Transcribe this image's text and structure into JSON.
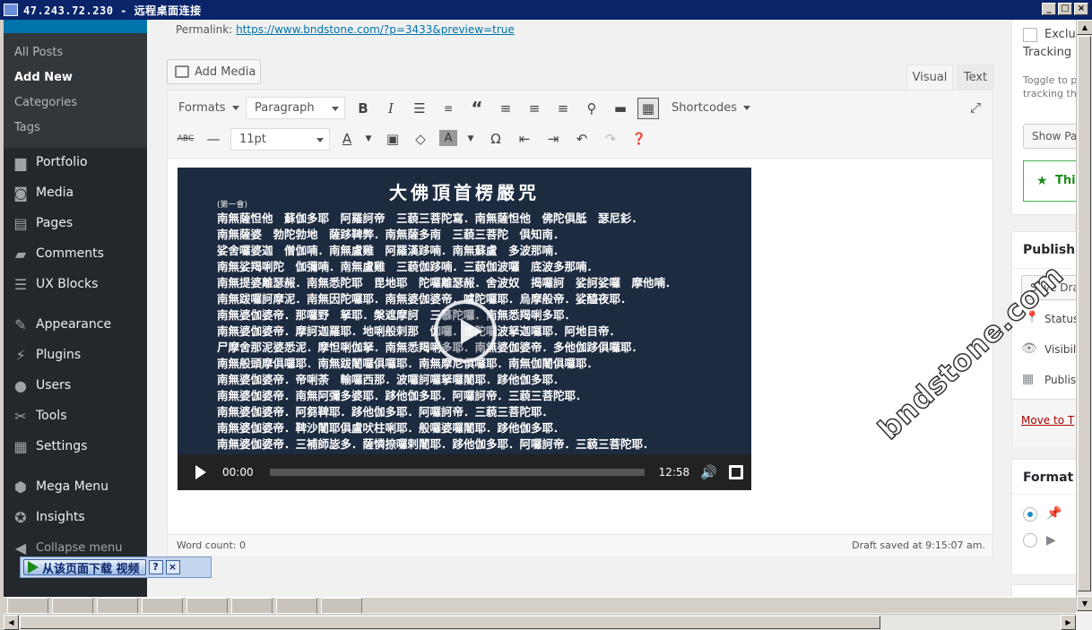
{
  "window": {
    "title": "47.243.72.230 - 远程桌面连接",
    "controls": [
      "_",
      "□",
      "×"
    ]
  },
  "sidebar": {
    "submenu": [
      "All Posts",
      "Add New",
      "Categories",
      "Tags"
    ],
    "items": [
      {
        "label": "Portfolio",
        "icon": "portfolio-icon"
      },
      {
        "label": "Media",
        "icon": "media-icon"
      },
      {
        "label": "Pages",
        "icon": "pages-icon"
      },
      {
        "label": "Comments",
        "icon": "comments-icon"
      },
      {
        "label": "UX Blocks",
        "icon": "ux-blocks-icon"
      },
      {
        "label": "Appearance",
        "icon": "appearance-icon"
      },
      {
        "label": "Plugins",
        "icon": "plugins-icon"
      },
      {
        "label": "Users",
        "icon": "users-icon"
      },
      {
        "label": "Tools",
        "icon": "tools-icon"
      },
      {
        "label": "Settings",
        "icon": "settings-icon"
      },
      {
        "label": "Mega Menu",
        "icon": "mega-menu-icon"
      },
      {
        "label": "Insights",
        "icon": "insights-icon"
      }
    ],
    "collapse": "Collapse menu"
  },
  "editor": {
    "permalink_label": "Permalink:",
    "permalink_url": "https://www.bndstone.com/?p=3433&preview=true",
    "add_media": "Add Media",
    "tab_visual": "Visual",
    "tab_text": "Text",
    "formats": "Formats",
    "paragraph": "Paragraph",
    "shortcodes": "Shortcodes",
    "font_size": "11pt",
    "word_count": "Word count: 0",
    "draft_saved": "Draft saved at 9:15:07 am."
  },
  "video": {
    "title": "大佛頂首楞嚴咒",
    "subtitle": "(第一會)",
    "lines": [
      "南無薩怛他　蘇伽多耶　阿羅訶帝　三藐三菩陀寫．南無薩怛他　佛陀俱胝　瑟尼釤．",
      "南無薩婆　勃陀勃地　薩跢鞞弊．南無薩多南　三藐三菩陀　俱知南．",
      "娑舍囉婆迦　僧伽喃．南無盧雞　阿羅漢跢喃．南無蘇盧　多波那喃．",
      "南無娑羯唎陀　伽彌喃．南無盧雞　三藐伽跢喃．三藐伽波囉　底波多那喃．",
      "南無提婆離瑟赧．南無悉陀耶　毘地耶　陀囉離瑟赧．舍波奴　揭囉訶　娑訶娑囉　摩他喃．",
      "南無跋囉訶摩泥．南無因陀囉耶．南無婆伽婆帝．嚧陀囉耶．烏摩般帝．娑醯夜耶．",
      "南無婆伽婆帝．那囉野　拏耶．槃遮摩訶　三慕陀囉．南無悉羯唎多耶．",
      "南無婆伽婆帝．摩訶迦羅耶．地唎般剌那　伽囉．毘陀囉波拏迦囉耶．阿地目帝．",
      "尸摩舍那泥婆悉泥．摩怛唎伽拏．南無悉羯唎多耶．南無婆伽婆帝．多他伽跢俱囉耶．",
      "南無般頭摩俱囉耶．南無跋闍囉俱囉耶．南無摩尼俱囉耶．南無伽闍俱囉耶．",
      "南無婆伽婆帝．帝唎荼　輸囉西那．波囉訶囉拏囉闍耶．跢他伽多耶．",
      "南無婆伽婆帝．南無阿彌多婆耶．跢他伽多耶．阿囉訶帝．三藐三菩陀耶．",
      "南無婆伽婆帝．阿芻鞞耶．跢他伽多耶．阿囉訶帝．三藐三菩陀耶．",
      "南無婆伽婆帝．鞞沙闍耶俱盧吠柱唎耶．般囉婆囉闍耶．跢他伽多耶．",
      "南無婆伽婆帝．三補師毖多．薩憐捺囉剌闍耶．跢他伽多耶．阿囉訶帝．三藐三菩陀耶．"
    ],
    "time_current": "00:00",
    "time_total": "12:58"
  },
  "right_column": {
    "exclude": "Exclu",
    "tracking": "Tracking",
    "toggle_line1": "Toggle to p",
    "toggle_line2": "tracking th",
    "show_button": "Show Pa",
    "green_text": "This",
    "publish_heading": "Publish",
    "save_draft": "Save Dra",
    "status": "Status",
    "visibility": "Visibil",
    "publish_date": "Publis",
    "move_trash": "Move to T",
    "format_heading": "Format"
  },
  "watermark": "bndstone.com",
  "download_bar": {
    "label": "从该页面下载 视频",
    "help": "?",
    "close": "×"
  },
  "colors": {
    "sidebar_bg": "#23282d",
    "submenu_bg": "#32373c",
    "accent": "#0073aa",
    "titlebar": "#0a246a"
  }
}
